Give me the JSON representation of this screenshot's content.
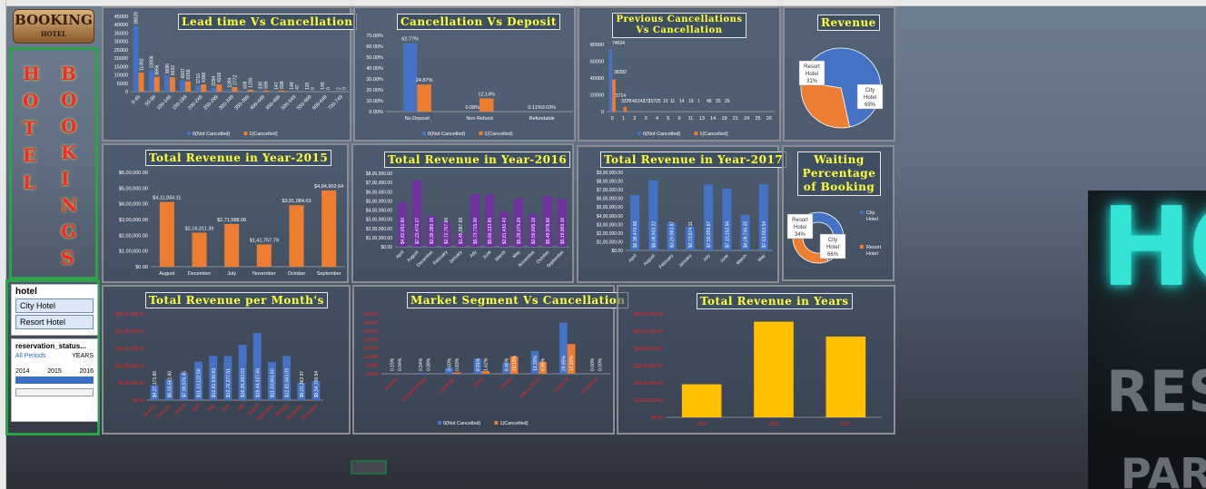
{
  "logo": {
    "text": "BOOKING",
    "sub": "HOTEL"
  },
  "side_title": {
    "col1": [
      "H",
      "O",
      "T",
      "E",
      "L"
    ],
    "col2": [
      "B",
      "O",
      "O",
      "K",
      "I",
      "N",
      "G",
      "S"
    ]
  },
  "slicer": {
    "title": "hotel",
    "items": [
      "City Hotel",
      "Resort Hotel"
    ]
  },
  "timeline": {
    "title": "reservation_status...",
    "period": "All Periods",
    "level": "YEARS",
    "years": [
      "2014",
      "2015",
      "2016"
    ]
  },
  "colors": {
    "blue": "#4472c4",
    "orange": "#ed7d31",
    "purple": "#7030a0",
    "gold": "#ffc000",
    "title": "#ffff3a"
  },
  "chart_data": [
    {
      "id": "lead",
      "type": "bar",
      "title": "Lead time Vs Cancellation",
      "categories": [
        "0-49",
        "50-99",
        "100-149",
        "150-199",
        "200-249",
        "250-299",
        "300-349",
        "350-399",
        "400-449",
        "450-499",
        "500-549",
        "550-599",
        "600-649",
        "700-749"
      ],
      "series": [
        {
          "name": "0(Not Cancelled)",
          "values": [
            39029,
            12806,
            9696,
            6837,
            3710,
            2294,
            1284,
            609,
            339,
            147,
            148,
            119,
            145,
            2
          ]
        },
        {
          "name": "1(Cancelled)",
          "values": [
            11392,
            8896,
            8632,
            6158,
            4368,
            4318,
            2772,
            1200,
            696,
            698,
            47,
            0,
            0,
            0
          ]
        }
      ],
      "ylim": [
        0,
        45000
      ],
      "yticks": [
        "45000",
        "40000",
        "35000",
        "30000",
        "25000",
        "20000",
        "15000",
        "10000",
        "5000",
        "0"
      ]
    },
    {
      "id": "deposit",
      "type": "bar",
      "title": "Cancellation Vs Deposit",
      "categories": [
        "No Deposit",
        "Non Refund",
        "Refundable"
      ],
      "series": [
        {
          "name": "0(Not Cancelled)",
          "values": [
            62.77,
            0.08,
            0.11
          ],
          "labels": [
            "62.77%",
            "0.08%",
            "0.11%"
          ]
        },
        {
          "name": "1(Cancelled)",
          "values": [
            24.87,
            12.14,
            0.03
          ],
          "labels": [
            "24.87%",
            "12.14%",
            "0.03%"
          ]
        }
      ],
      "yticks": [
        "70.00%",
        "60.00%",
        "50.00%",
        "40.00%",
        "30.00%",
        "20.00%",
        "10.00%",
        "0.00%"
      ]
    },
    {
      "id": "prev",
      "type": "bar",
      "title": "Previous Cancellations Vs Cancellation",
      "categories": [
        "0",
        "1",
        "2",
        "3",
        "4",
        "5",
        "6",
        "11",
        "13",
        "14",
        "19",
        "21",
        "24",
        "25",
        "26"
      ],
      "series": [
        {
          "name": "0(Not Cancelled)",
          "values": [
            74624,
            337,
            78,
            49,
            0,
            2,
            4,
            5,
            2,
            10,
            11,
            14,
            19,
            1,
            48
          ]
        },
        {
          "name": "1(Cancelled)",
          "values": [
            38282,
            5714,
            38,
            12,
            31,
            17,
            15,
            25,
            0,
            0,
            0,
            0,
            0,
            0,
            0
          ]
        }
      ],
      "value_labels": [
        "74624",
        "38282",
        "5714",
        "337",
        "78",
        "49",
        "247",
        "172",
        "157",
        "25",
        "10",
        "11",
        "14",
        "19",
        "1",
        "48",
        "25",
        "26"
      ],
      "yticks": [
        "80000",
        "60000",
        "40000",
        "20000",
        "0"
      ]
    },
    {
      "id": "revenue",
      "type": "pie",
      "title": "Revenue",
      "labels": [
        "City Hotel",
        "Resort Hotel"
      ],
      "values": [
        69,
        31
      ],
      "pct": [
        "69%",
        "31%"
      ]
    },
    {
      "id": "waiting",
      "type": "pie",
      "title": "Waiting Percentage of Booking",
      "labels": [
        "City Hotel",
        "Resort Hotel"
      ],
      "values": [
        66,
        34
      ],
      "pct": [
        "66%",
        "34%"
      ]
    },
    {
      "id": "y2015",
      "type": "bar",
      "title": "Total Revenue in Year-2015",
      "categories": [
        "August",
        "December",
        "July",
        "November",
        "October",
        "September"
      ],
      "values": [
        411934.11,
        216311.39,
        271588.06,
        141757.79,
        391084.63,
        484902.64
      ],
      "labels": [
        "$4,11,934.11",
        "$2,16,311.39",
        "$2,71,588.06",
        "$1,41,757.79",
        "$3,91,084.63",
        "$4,84,902.64"
      ],
      "yticks": [
        "$6,00,000.00",
        "$5,00,000.00",
        "$4,00,000.00",
        "$3,00,000.00",
        "$2,00,000.00",
        "$1,00,000.00",
        "$0.00"
      ],
      "ylim": [
        0,
        600000
      ]
    },
    {
      "id": "y2016",
      "type": "bar",
      "title": "Total Revenue in Year-2016",
      "categories": [
        "April",
        "August",
        "December",
        "February",
        "January",
        "July",
        "June",
        "March",
        "May",
        "November",
        "October",
        "September"
      ],
      "values": [
        482651.9,
        723470.27,
        338389.15,
        272767.66,
        145597.69,
        573715.3,
        566133.95,
        381430.43,
        528075.29,
        359605.18,
        549978.66,
        518969.16
      ],
      "labels": [
        "$4,82,651.90",
        "$7,23,470.27",
        "$3,38,389.15",
        "$2,72,767.66",
        "$1,45,597.69",
        "$5,73,715.30",
        "$5,66,133.95",
        "$3,81,430.43",
        "$5,28,075.29",
        "$3,59,605.18",
        "$5,49,978.66",
        "$5,18,969.16"
      ],
      "yticks": [
        "$8,00,000.00",
        "$7,00,000.00",
        "$6,00,000.00",
        "$5,00,000.00",
        "$4,00,000.00",
        "$3,00,000.00",
        "$2,00,000.00",
        "$1,00,000.00",
        "$0.00"
      ],
      "ylim": [
        0,
        800000
      ]
    },
    {
      "id": "y2017",
      "type": "bar",
      "title": "Total Revenue in Year-2017",
      "categories": [
        "April",
        "August",
        "February",
        "January",
        "July",
        "June",
        "March",
        "May"
      ],
      "values": [
        638470.68,
        808933.22,
        320983.87,
        273674.11,
        759959.67,
        710153.56,
        408746.02,
        763553.54
      ],
      "labels": [
        "$6,38,470.68",
        "$8,08,933.22",
        "$3,20,983.87",
        "$2,73,674.11",
        "$7,59,959.67",
        "$7,10,153.56",
        "$4,08,746.02",
        "$7,63,553.54"
      ],
      "yticks": [
        "$9,00,000.00",
        "$8,00,000.00",
        "$7,00,000.00",
        "$6,00,000.00",
        "$5,00,000.00",
        "$4,00,000.00",
        "$3,00,000.00",
        "$2,00,000.00",
        "$1,00,000.00",
        "$0.00"
      ],
      "ylim": [
        0,
        900000
      ]
    },
    {
      "id": "month",
      "type": "bar",
      "title": "Total Revenue per Month's",
      "categories": [
        "January",
        "February",
        "March",
        "April",
        "May",
        "June",
        "July",
        "August",
        "September",
        "October",
        "November",
        "December"
      ],
      "values": [
        427171.8,
        593661.8,
        790576.45,
        1113122.58,
        1281638.83,
        1276277.51,
        1605383.03,
        1944327.6,
        1103861.8,
        1281063.09,
        501362.97,
        554700.54
      ],
      "labels": [
        "$4,27,171.80",
        "$5,93,661.80",
        "$7,90,576.45",
        "$11,13,122.58",
        "$12,81,638.83",
        "$12,76,277.51",
        "$16,05,383.03",
        "$19,44,327.60",
        "$11,03,861.80",
        "$12,81,063.09",
        "$5,01,362.97",
        "$5,54,700.54"
      ],
      "yticks": [
        "$25,00,000.00",
        "$20,00,000.00",
        "$15,00,000.00",
        "$10,00,000.00",
        "$5,00,000.00",
        "$0.00"
      ],
      "ylim": [
        0,
        2500000
      ]
    },
    {
      "id": "segment",
      "type": "bar",
      "title": "Market Segment Vs Cancellation",
      "categories": [
        "Aviation",
        "Complementary",
        "Corporate",
        "Direct",
        "Groups",
        "Offline TA/TO",
        "Online TA",
        "Undefined"
      ],
      "series": [
        {
          "name": "0(Not Cancelled)",
          "values": [
            0.15,
            0.54,
            3.6,
            8.91,
            6.46,
            13.33,
            29.85,
            0.0
          ],
          "labels": [
            "0.15%",
            "0.54%",
            "3.60%",
            "8.91%",
            "6.46%",
            "13.33%",
            "29.85%",
            "0.00%"
          ]
        },
        {
          "name": "1(Cancelled)",
          "values": [
            0.04,
            0.08,
            0.83,
            1.62,
            10.13,
            6.96,
            17.37,
            0.0
          ],
          "labels": [
            "0.04%",
            "0.08%",
            "0.83%",
            "1.62%",
            "10.13%",
            "6.96%",
            "17.37%",
            "0.00%"
          ]
        }
      ],
      "yticks": [
        "35.00%",
        "30.00%",
        "25.00%",
        "20.00%",
        "15.00%",
        "10.00%",
        "5.00%",
        "0.00%"
      ]
    },
    {
      "id": "years",
      "type": "bar",
      "title": "Total Revenue in Years",
      "categories": [
        "2015",
        "2016",
        "2017"
      ],
      "values": [
        1917578.62,
        5549793.88,
        4685399.63
      ],
      "yticks": [
        "$60,00,000.00",
        "$50,00,000.00",
        "$40,00,000.00",
        "$30,00,000.00",
        "$20,00,000.00",
        "$10,00,000.00",
        "$0.00"
      ],
      "ylim": [
        0,
        6000000
      ]
    }
  ]
}
